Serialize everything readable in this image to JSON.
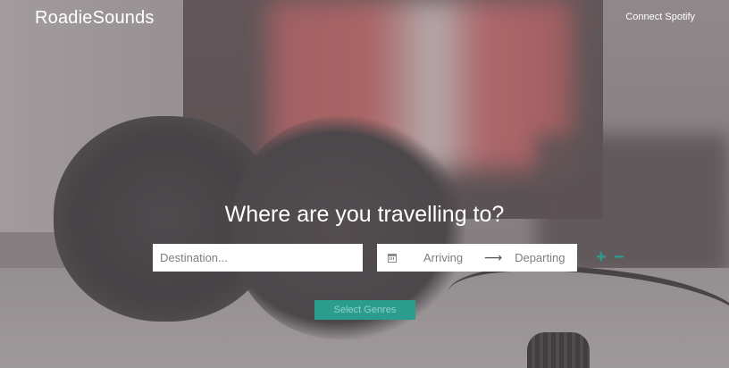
{
  "header": {
    "brand": "RoadieSounds",
    "connect_label": "Connect Spotify"
  },
  "hero": {
    "headline": "Where are you travelling to?"
  },
  "search": {
    "destination_placeholder": "Destination...",
    "destination_value": "",
    "arriving_label": "Arriving",
    "arrow_glyph": "⟶",
    "departing_label": "Departing",
    "add_glyph": "+",
    "remove_glyph": "−",
    "select_genres_label": "Select Genres"
  },
  "icons": {
    "calendar": "calendar-icon",
    "add": "plus-icon",
    "remove": "minus-icon",
    "arrow": "arrow-right-icon"
  },
  "colors": {
    "accent": "#2a9d8f",
    "accent_text": "#8fd1c6",
    "text_light": "#ffffff"
  }
}
